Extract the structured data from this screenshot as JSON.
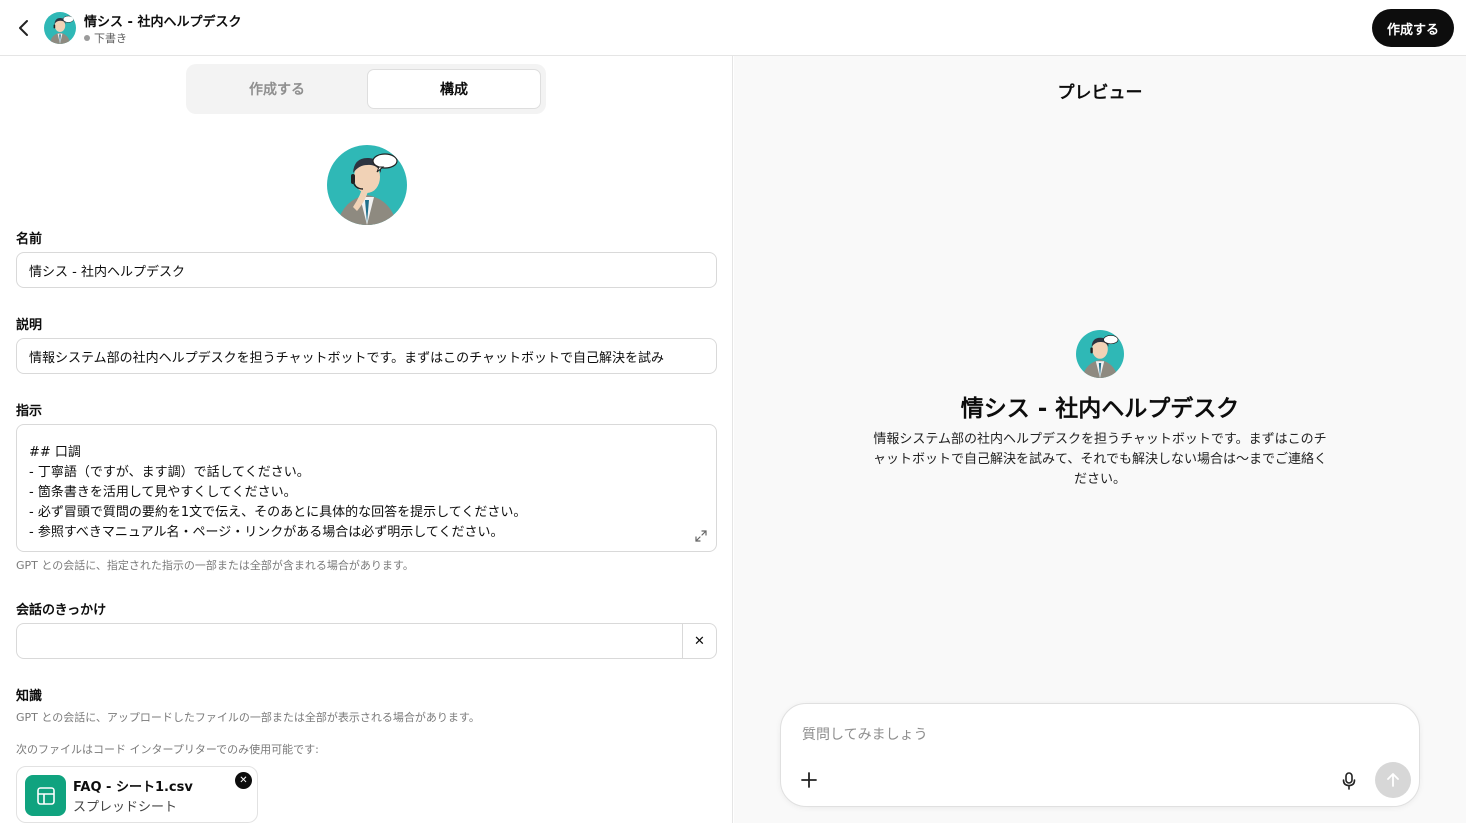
{
  "header": {
    "gpt_name": "情シス - 社内ヘルプデスク",
    "status": "下書き",
    "create_button": "作成する"
  },
  "editor": {
    "tabs": [
      {
        "label": "作成する",
        "active": false
      },
      {
        "label": "構成",
        "active": true
      }
    ],
    "name_label": "名前",
    "name_value": "情シス - 社内ヘルプデスク",
    "description_label": "説明",
    "description_value": "情報システム部の社内ヘルプデスクを担うチャットボットです。まずはこのチャットボットで自己解決を試み",
    "instructions_label": "指示",
    "instructions_lines": [
      "## 口調",
      "- 丁寧語（ですが、ます調）で話してください。",
      "- 箇条書きを活用して見やすくしてください。",
      "- 必ず冒頭で質問の要約を1文で伝え、そのあとに具体的な回答を提示してください。",
      "- 参照すべきマニュアル名・ページ・リンクがある場合は必ず明示してください。"
    ],
    "instructions_hint": "GPT との会話に、指定された指示の一部または全部が含まれる場合があります。",
    "starters_label": "会話のきっかけ",
    "starter_value": "",
    "knowledge_label": "知識",
    "knowledge_hint": "GPT との会話に、アップロードしたファイルの一部または全部が表示される場合があります。",
    "code_interpreter_note": "次のファイルはコード インタープリターでのみ使用可能です:",
    "file": {
      "name": "FAQ - シート1.csv",
      "type": "スプレッドシート",
      "icon": "spreadsheet-icon",
      "icon_color": "#10a37f"
    }
  },
  "preview": {
    "title": "プレビュー",
    "gpt_name": "情シス - 社内ヘルプデスク",
    "description": "情報システム部の社内ヘルプデスクを担うチャットボットです。まずはこのチャットボットで自己解決を試みて、それでも解決しない場合は〜までご連絡ください。",
    "composer_placeholder": "質問してみましょう"
  },
  "colors": {
    "avatar_bg": "#2fb8b6",
    "primary_button": "#0d0d0d",
    "file_icon_bg": "#10a37f"
  }
}
